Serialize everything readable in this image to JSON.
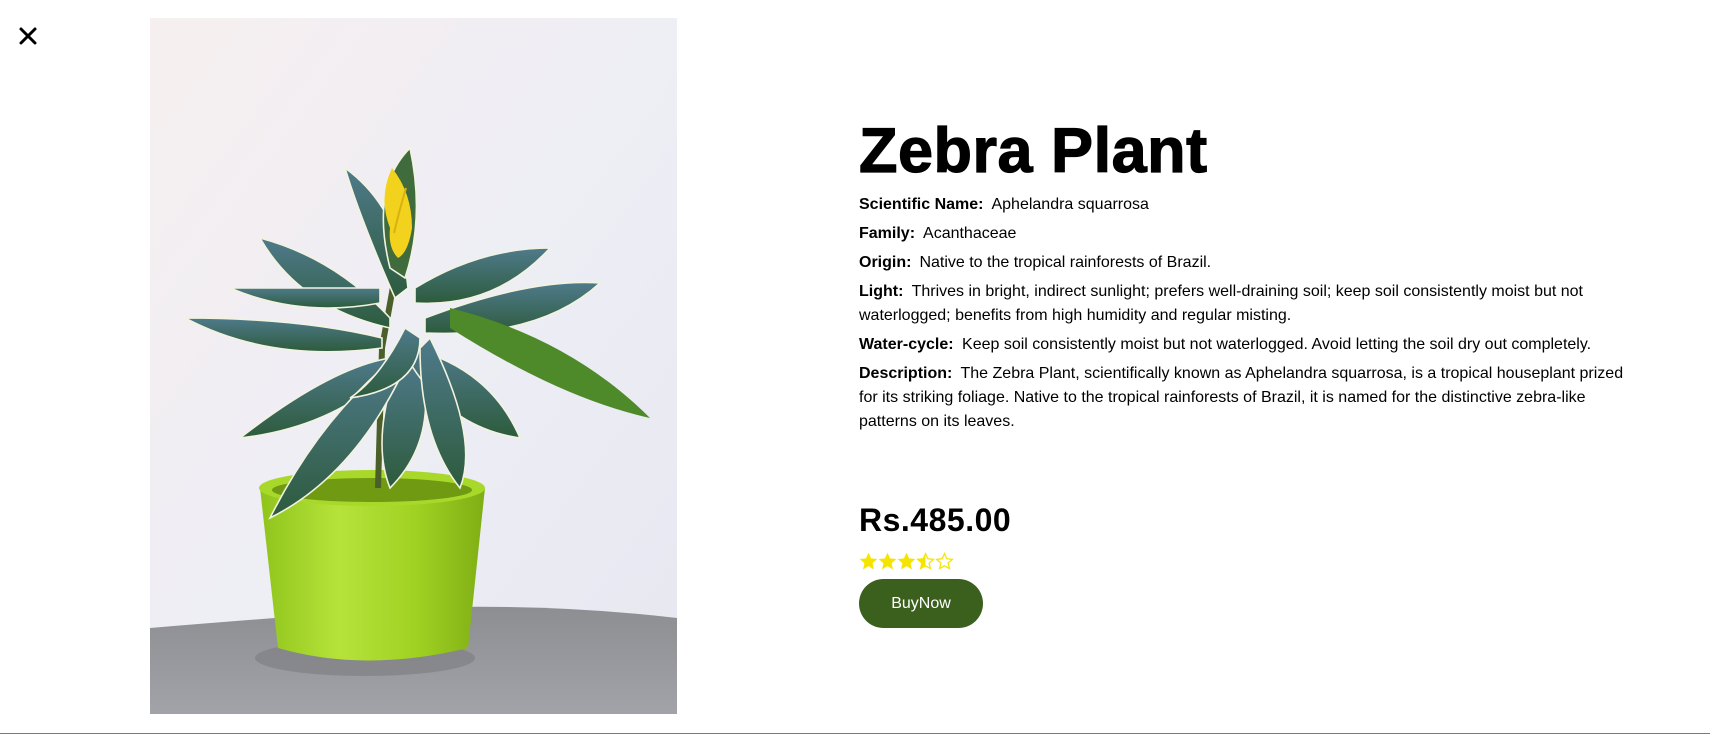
{
  "modal": {
    "close_icon": "close-icon",
    "image_alt": "Zebra Plant"
  },
  "product": {
    "name": "Zebra Plant",
    "fields": {
      "scientific_name": {
        "label": "Scientific Name:",
        "value": "Aphelandra squarrosa"
      },
      "family": {
        "label": "Family:",
        "value": "Acanthaceae"
      },
      "origin": {
        "label": "Origin:",
        "value": "Native to the tropical rainforests of Brazil."
      },
      "light": {
        "label": "Light:",
        "value": "Thrives in bright, indirect sunlight; prefers well-draining soil; keep soil consistently moist but not waterlogged; benefits from high humidity and regular misting."
      },
      "water_cycle": {
        "label": "Water-cycle:",
        "value": "Keep soil consistently moist but not waterlogged. Avoid letting the soil dry out completely."
      },
      "description": {
        "label": "Description:",
        "value": "The Zebra Plant, scientifically known as Aphelandra squarrosa, is a tropical houseplant prized for its striking foliage. Native to the tropical rainforests of Brazil, it is named for the distinctive zebra-like patterns on its leaves."
      }
    },
    "price": "Rs.485.00",
    "rating": {
      "value": 3.5,
      "max": 5,
      "color": "#f5e400"
    },
    "buy_label": "BuyNow"
  },
  "colors": {
    "button_bg": "#3b5f1c",
    "button_text": "#ffffff"
  }
}
